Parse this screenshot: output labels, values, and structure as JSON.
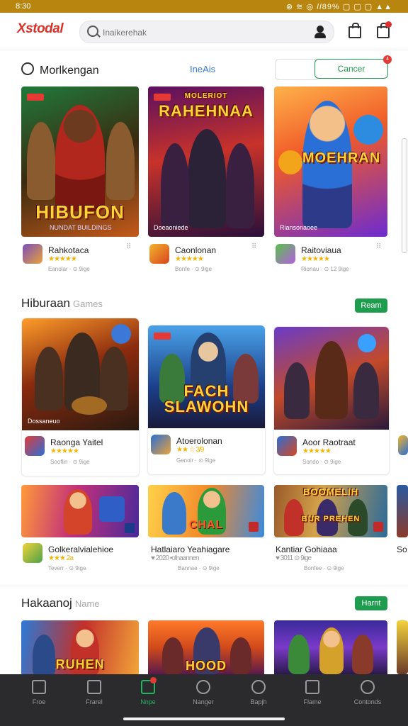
{
  "status": {
    "time": "8:30",
    "right": "⊗ ≋ ◎ 𝑙𝑙89% ▢ ▢ ▢ ▲▲"
  },
  "header": {
    "logo": "Xstodal",
    "search_placeholder": "Inaikerehak"
  },
  "top_section": {
    "title": "Morlkengan",
    "tab": "IneAis",
    "button": "Cancer",
    "button_badge": "4",
    "cards": [
      {
        "art_text": "HIBUFON",
        "art_small": "NUNDAT BUILDINGS",
        "name": "Rahkotaca",
        "stars": "★★★★★",
        "meta": "Eanolar ·  ⊙ 9ige"
      },
      {
        "art_text": "RAHEHNAA",
        "art_top": "MOLERIOT",
        "art_small": "Doeaoniede",
        "name": "Caonlonan",
        "stars": "★★★★★",
        "meta": "Bonfe ·  ⊙ 9ige"
      },
      {
        "art_text": "MOEHRAN",
        "art_small": "Riansonaoee",
        "name": "Raitoviaua",
        "stars": "★★★★★",
        "meta": "Rionau ·  ⊙ 12 9ige"
      }
    ]
  },
  "section2": {
    "title": "Hiburaan",
    "subtitle": "Games",
    "button": "Ream",
    "cards": [
      {
        "art_small": "Dossaneuo",
        "name": "Raonga Yaitel",
        "stars": "★★★★★",
        "meta": "Sooflin ·  ⊙ 9ige"
      },
      {
        "art_text": "FACH SLAWOHN",
        "name": "Atoerolonan",
        "stars": "★★ ☆ 3/9",
        "meta": "Genoir ·  ⊙ 9ige"
      },
      {
        "name": "Aoor Raotraat",
        "stars": "★★★★★",
        "meta": "Sondo ·  ⊙ 9ige"
      }
    ]
  },
  "row3": {
    "cards": [
      {
        "name": "Golkeralvialehioe",
        "stars": "★★★ 2a",
        "meta": "Teverr ·  ⊙ 9ige"
      },
      {
        "art_text": "CHAL",
        "name": "Hatlaiaro Yeahiagare",
        "stars": "♥ 2020 •ofnaannen",
        "meta": "Bannae ·  ⊙ 9ige"
      },
      {
        "art_text": "BOOMELIH",
        "art_bottom": "BUR PREHEN",
        "name": "Kantiar Gohiaaa",
        "stars": "♥ 3011  ⊙ 9ige",
        "meta": "Bonfee ·  ⊙ 9ige"
      },
      {
        "name": "So"
      }
    ]
  },
  "section3": {
    "title": "Hakaanoj",
    "subtitle": "Name",
    "button": "Harnt",
    "cards": [
      {
        "art_text": "RUHEN"
      },
      {
        "art_text": "HOOD"
      },
      {
        "art_text": ""
      }
    ]
  },
  "bottom_nav": [
    {
      "label": "Froe",
      "icon": "home-icon"
    },
    {
      "label": "Frarel",
      "icon": "grid-icon"
    },
    {
      "label": "Nnpe",
      "icon": "apps-icon",
      "active": true
    },
    {
      "label": "Nanger",
      "icon": "clock-icon"
    },
    {
      "label": "Bapjh",
      "icon": "search-icon"
    },
    {
      "label": "Flame",
      "icon": "chart-icon"
    },
    {
      "label": "Contonds",
      "icon": "magnifier-icon"
    }
  ],
  "colors": {
    "accent": "#1f9d4f",
    "status_bar": "#b8860f",
    "nav_bg": "#2b2b2e",
    "logo": "#d8322a"
  }
}
